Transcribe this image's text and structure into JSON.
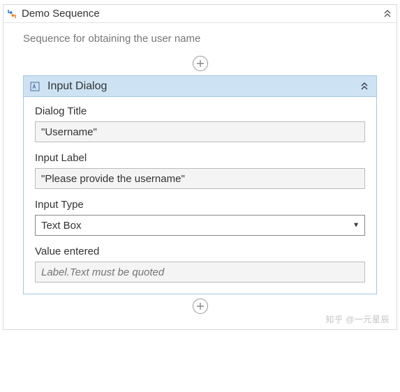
{
  "sequence": {
    "title": "Demo Sequence",
    "description": "Sequence for obtaining the user name"
  },
  "activity": {
    "title": "Input Dialog",
    "fields": {
      "dialog_title": {
        "label": "Dialog Title",
        "value": "\"Username\""
      },
      "input_label": {
        "label": "Input Label",
        "value": "\"Please provide the username\""
      },
      "input_type": {
        "label": "Input Type",
        "value": "Text Box"
      },
      "value_entered": {
        "label": "Value entered",
        "placeholder": "Label.Text must be quoted"
      }
    }
  },
  "watermark": "知乎 @一元星辰"
}
